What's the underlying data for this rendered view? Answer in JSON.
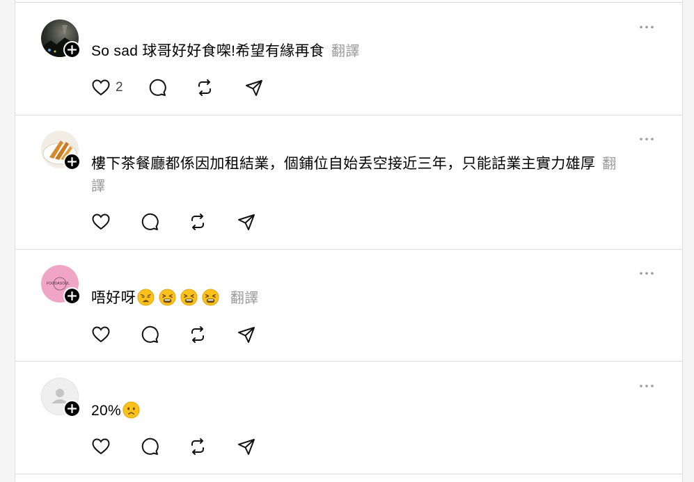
{
  "posts": [
    {
      "text": "So sad 球哥好好食㗎!希望有緣再食",
      "translate_label": "翻譯",
      "like_count": "2",
      "avatar": "dark-night-photo-avatar",
      "emojis": []
    },
    {
      "text": "樓下茶餐廳都係因加租結業，個鋪位自始丢空接近三年，只能話業主實力雄厚",
      "translate_label": "翻譯",
      "like_count": "",
      "avatar": "food-photo-avatar",
      "emojis": []
    },
    {
      "text": "唔好呀",
      "translate_label": "翻譯",
      "like_count": "",
      "avatar": "pink-logo-avatar",
      "avatar_text": "FOODASOUL",
      "emojis": [
        "weary-face",
        "tired-face",
        "tired-face",
        "tired-face"
      ]
    },
    {
      "text": "20%",
      "translate_label": "",
      "like_count": "",
      "avatar": "default-user-avatar",
      "emojis": [
        "worried-face"
      ]
    }
  ],
  "colors": {
    "accent": "#000000",
    "muted": "#999999",
    "divider": "#dcdcdc",
    "pink": "#f0a5c4"
  }
}
